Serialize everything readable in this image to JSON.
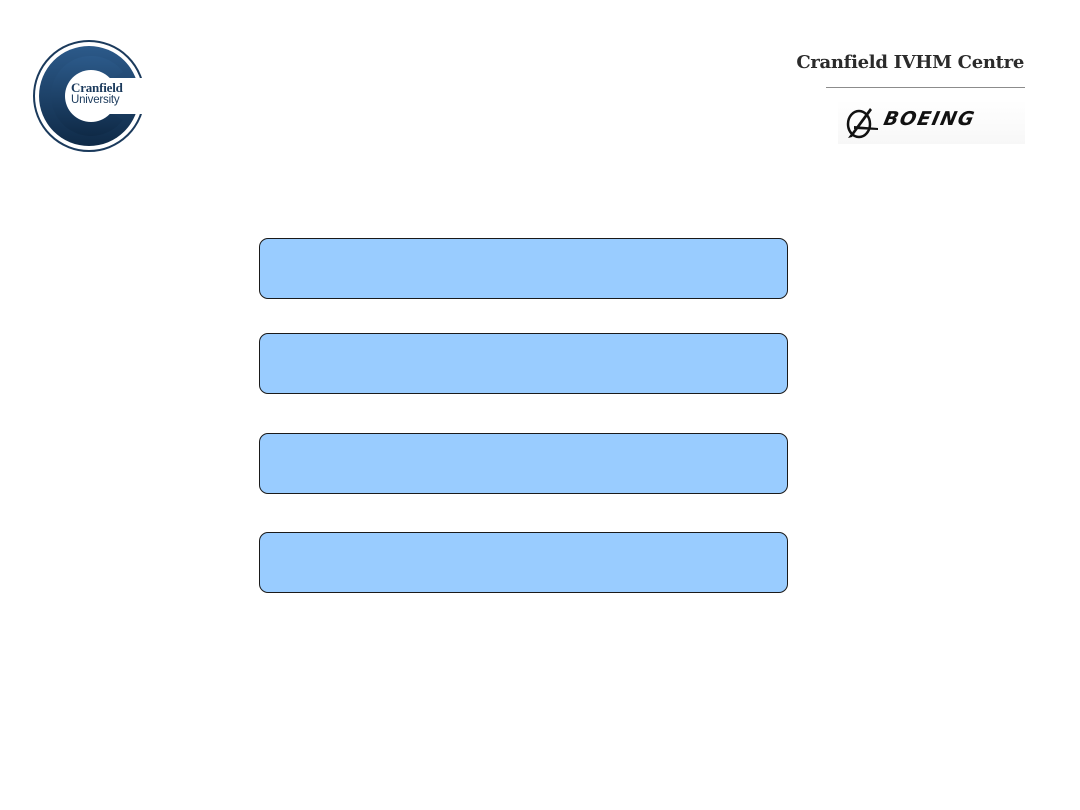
{
  "header": {
    "left_logo": {
      "name": "cranfield-university-logo",
      "line1": "Cranfield",
      "line2": "University",
      "color": "#1b3a5c"
    },
    "right_title": "Cranfield IVHM Centre",
    "right_logo": {
      "name": "boeing-logo",
      "wordmark": "BOEING"
    }
  },
  "boxes": [
    {
      "label": "",
      "fill": "#99ccff"
    },
    {
      "label": "",
      "fill": "#99ccff"
    },
    {
      "label": "",
      "fill": "#99ccff"
    },
    {
      "label": "",
      "fill": "#99ccff"
    }
  ]
}
